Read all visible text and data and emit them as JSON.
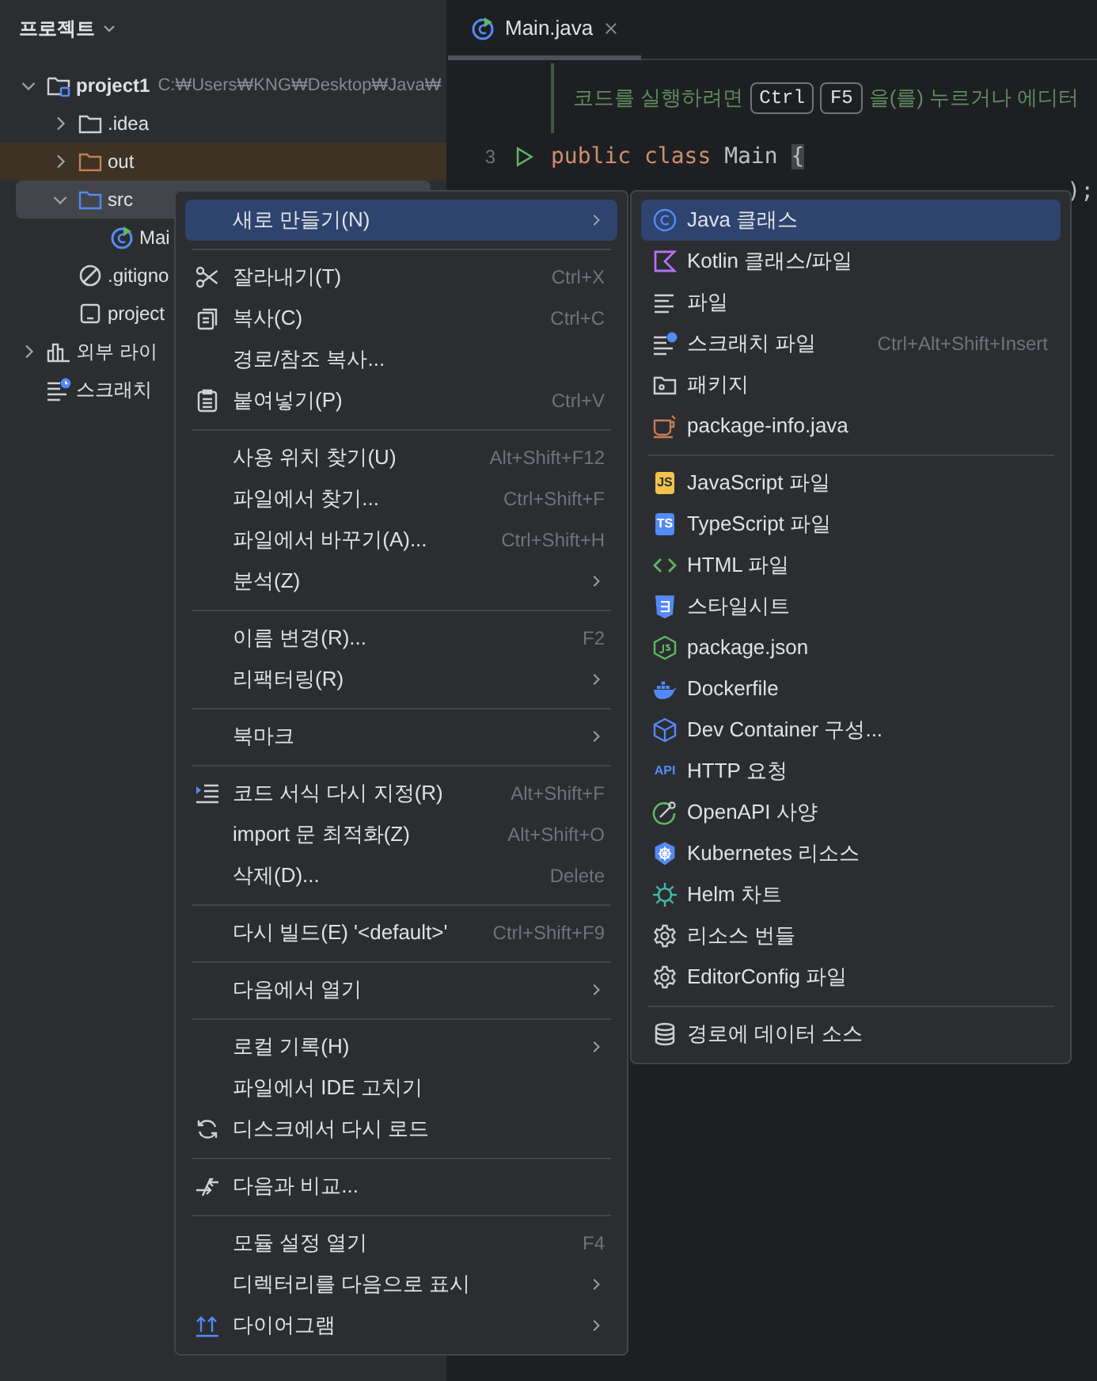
{
  "project_panel": {
    "title": "프로젝트",
    "tree": [
      {
        "label": "project1",
        "path": "C:₩Users₩KNG₩Desktop₩Java₩",
        "kind": "module",
        "expanded": true,
        "selected": false,
        "children": [
          {
            "label": ".idea",
            "kind": "folder",
            "expanded": false,
            "selected": false
          },
          {
            "label": "out",
            "kind": "excluded",
            "expanded": false,
            "selected": false
          },
          {
            "label": "src",
            "kind": "source",
            "expanded": true,
            "selected": true,
            "children": [
              {
                "label": "Mai",
                "kind": "java",
                "selected": false
              }
            ]
          },
          {
            "label": ".gitigno",
            "kind": "ignore",
            "selected": false
          },
          {
            "label": "project",
            "kind": "iml",
            "selected": false
          }
        ]
      },
      {
        "label": "외부 라이",
        "kind": "library",
        "expanded": false,
        "selected": false
      },
      {
        "label": "스크래치",
        "kind": "scratch",
        "selected": false
      }
    ]
  },
  "editor": {
    "tabs": [
      {
        "label": "Main.java",
        "selected": true
      }
    ],
    "hint": [
      {
        "kind": "text",
        "text": "코드를 실행하려면"
      },
      {
        "kind": "key",
        "text": "Ctrl"
      },
      {
        "kind": "key",
        "text": "F5"
      },
      {
        "kind": "text",
        "text": "을(를) 누르거나 에디터"
      }
    ],
    "lines": [
      {
        "number": "3",
        "run": true,
        "kind": "code",
        "tokens": [
          {
            "kind": "keyword",
            "text": "public class "
          },
          {
            "kind": "plain",
            "text": "Main "
          },
          {
            "kind": "brace",
            "text": "{"
          }
        ]
      },
      {
        "kind": "tail",
        "tokens": [
          {
            "kind": "plain",
            "text": ");"
          }
        ]
      }
    ]
  },
  "context_menu": {
    "items": [
      {
        "kind": "item",
        "label": "새로 만들기(N)",
        "submenu": true,
        "selected": true
      },
      {
        "kind": "separator"
      },
      {
        "kind": "item",
        "label": "잘라내기(T)",
        "shortcut": "Ctrl+X",
        "selected": false
      },
      {
        "kind": "item",
        "label": "복사(C)",
        "shortcut": "Ctrl+C",
        "selected": false
      },
      {
        "kind": "item",
        "label": "경로/참조 복사...",
        "selected": false
      },
      {
        "kind": "item",
        "label": "붙여넣기(P)",
        "shortcut": "Ctrl+V",
        "selected": false
      },
      {
        "kind": "separator"
      },
      {
        "kind": "item",
        "label": "사용 위치 찾기(U)",
        "shortcut": "Alt+Shift+F12",
        "selected": false
      },
      {
        "kind": "item",
        "label": "파일에서 찾기...",
        "shortcut": "Ctrl+Shift+F",
        "selected": false
      },
      {
        "kind": "item",
        "label": "파일에서 바꾸기(A)...",
        "shortcut": "Ctrl+Shift+H",
        "selected": false
      },
      {
        "kind": "item",
        "label": "분석(Z)",
        "submenu": true,
        "selected": false
      },
      {
        "kind": "separator"
      },
      {
        "kind": "item",
        "label": "이름 변경(R)...",
        "shortcut": "F2",
        "selected": false
      },
      {
        "kind": "item",
        "label": "리팩터링(R)",
        "submenu": true,
        "selected": false
      },
      {
        "kind": "separator"
      },
      {
        "kind": "item",
        "label": "북마크",
        "submenu": true,
        "selected": false
      },
      {
        "kind": "separator"
      },
      {
        "kind": "item",
        "label": "코드 서식 다시 지정(R)",
        "shortcut": "Alt+Shift+F",
        "selected": false
      },
      {
        "kind": "item",
        "label": "import 문 최적화(Z)",
        "shortcut": "Alt+Shift+O",
        "selected": false
      },
      {
        "kind": "item",
        "label": "삭제(D)...",
        "shortcut": "Delete",
        "selected": false
      },
      {
        "kind": "separator"
      },
      {
        "kind": "item",
        "label": "다시 빌드(E) '<default>'",
        "shortcut": "Ctrl+Shift+F9",
        "selected": false
      },
      {
        "kind": "separator"
      },
      {
        "kind": "item",
        "label": "다음에서 열기",
        "submenu": true,
        "selected": false
      },
      {
        "kind": "separator"
      },
      {
        "kind": "item",
        "label": "로컬 기록(H)",
        "submenu": true,
        "selected": false
      },
      {
        "kind": "item",
        "label": "파일에서 IDE 고치기",
        "selected": false
      },
      {
        "kind": "item",
        "label": "디스크에서 다시 로드",
        "selected": false
      },
      {
        "kind": "separator"
      },
      {
        "kind": "item",
        "label": "다음과 비교...",
        "selected": false
      },
      {
        "kind": "separator"
      },
      {
        "kind": "item",
        "label": "모듈 설정 열기",
        "shortcut": "F4",
        "selected": false
      },
      {
        "kind": "item",
        "label": "디렉터리를 다음으로 표시",
        "submenu": true,
        "selected": false
      },
      {
        "kind": "item",
        "label": "다이어그램",
        "submenu": true,
        "selected": false
      }
    ]
  },
  "submenu": {
    "items": [
      {
        "kind": "item",
        "label": "Java 클래스",
        "selected": true
      },
      {
        "kind": "item",
        "label": "Kotlin 클래스/파일",
        "selected": false
      },
      {
        "kind": "item",
        "label": "파일",
        "selected": false
      },
      {
        "kind": "item",
        "label": "스크래치 파일",
        "shortcut": "Ctrl+Alt+Shift+Insert",
        "selected": false
      },
      {
        "kind": "item",
        "label": "패키지",
        "selected": false
      },
      {
        "kind": "item",
        "label": "package-info.java",
        "selected": false
      },
      {
        "kind": "separator"
      },
      {
        "kind": "item",
        "label": "JavaScript 파일",
        "badge": "JS",
        "selected": false
      },
      {
        "kind": "item",
        "label": "TypeScript 파일",
        "badge": "TS",
        "selected": false
      },
      {
        "kind": "item",
        "label": "HTML 파일",
        "selected": false
      },
      {
        "kind": "item",
        "label": "스타일시트",
        "selected": false
      },
      {
        "kind": "item",
        "label": "package.json",
        "selected": false
      },
      {
        "kind": "item",
        "label": "Dockerfile",
        "selected": false
      },
      {
        "kind": "item",
        "label": "Dev Container 구성...",
        "selected": false
      },
      {
        "kind": "item",
        "label": "HTTP 요청",
        "badge": "API",
        "selected": false
      },
      {
        "kind": "item",
        "label": "OpenAPI 사양",
        "selected": false
      },
      {
        "kind": "item",
        "label": "Kubernetes 리소스",
        "selected": false
      },
      {
        "kind": "item",
        "label": "Helm 차트",
        "selected": false
      },
      {
        "kind": "item",
        "label": "리소스 번들",
        "selected": false
      },
      {
        "kind": "item",
        "label": "EditorConfig 파일",
        "selected": false
      },
      {
        "kind": "separator"
      },
      {
        "kind": "item",
        "label": "경로에 데이터 소스",
        "selected": false
      }
    ]
  }
}
